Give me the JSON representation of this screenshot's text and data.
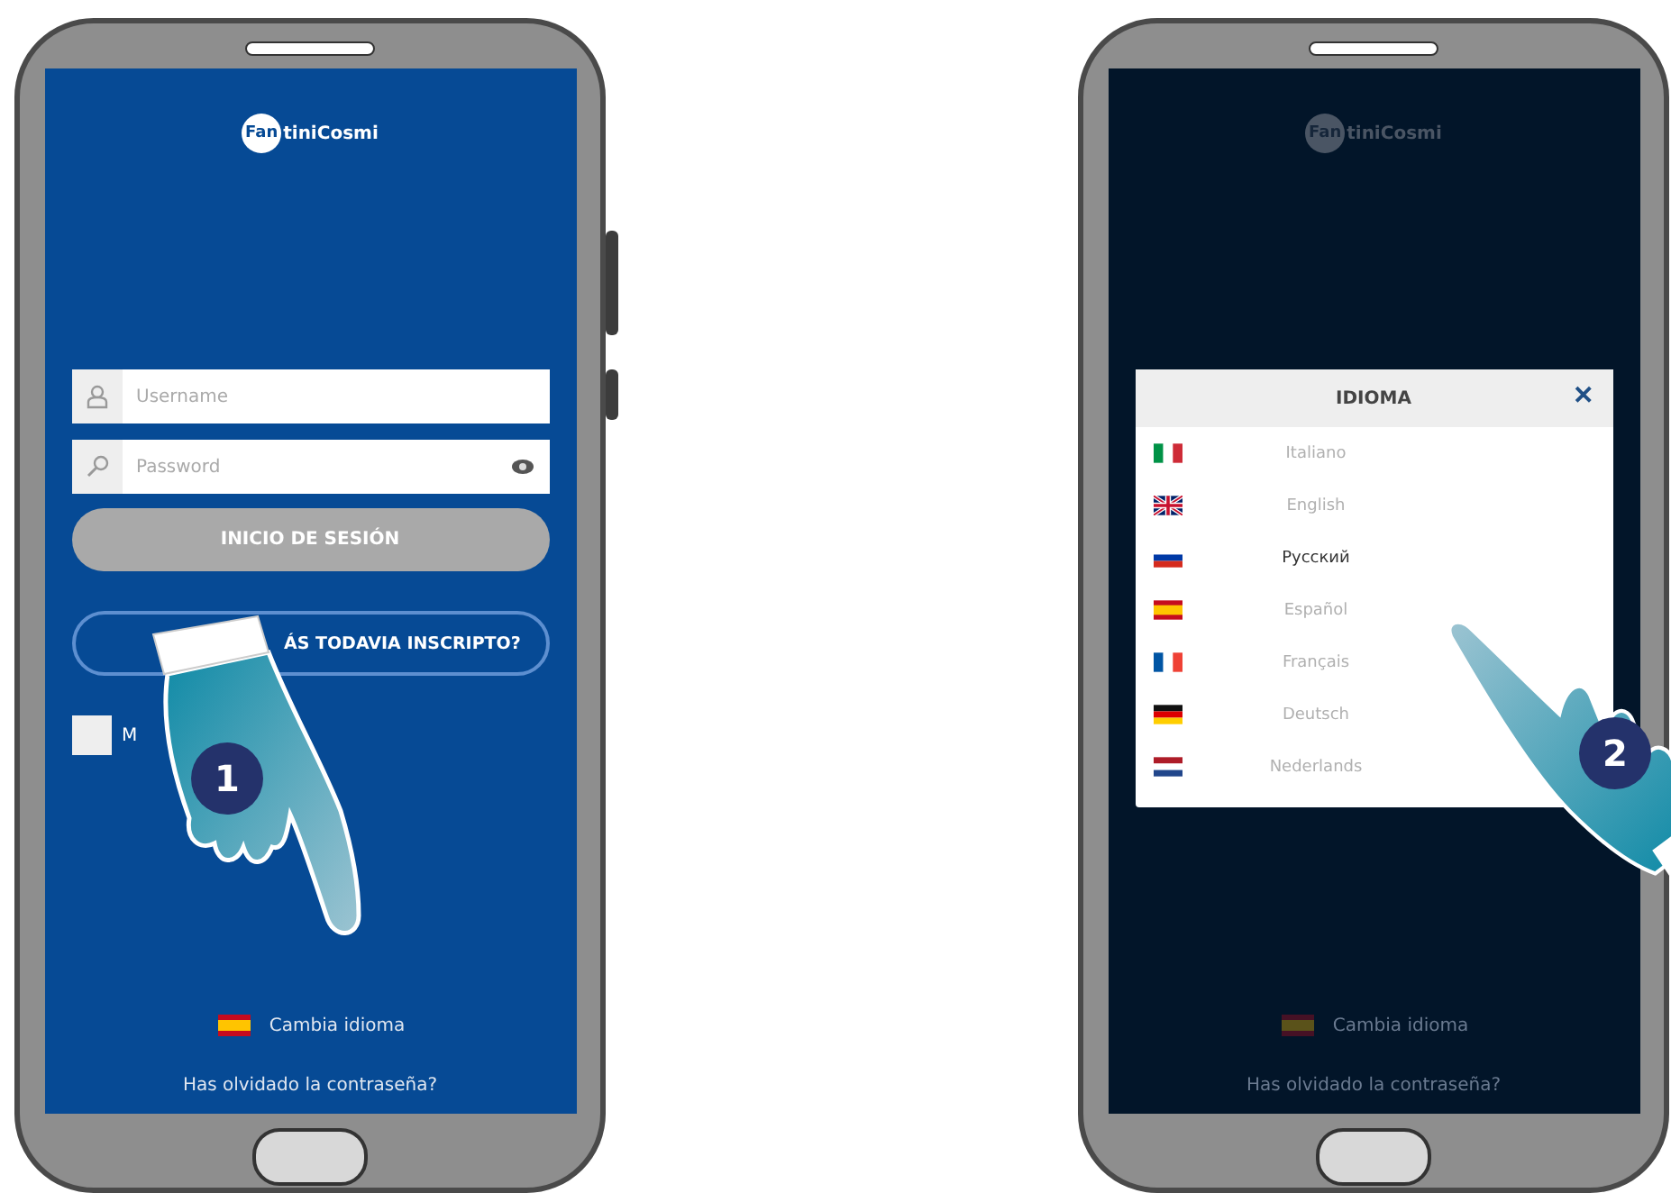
{
  "phones": [
    {
      "kind": "login",
      "side_buttons": true,
      "logo": {
        "mark": "Fan",
        "text": "tiniCosmi"
      },
      "username": {
        "placeholder": "Username"
      },
      "password": {
        "placeholder": "Password"
      },
      "login_button": "INICIO DE SESIÓN",
      "register_button": "ÁS TODAVIA INSCRIPTO?",
      "remember": {
        "label": "M",
        "checked": false
      },
      "language_link": {
        "label": "Cambia idioma",
        "kind": "es"
      },
      "forgot_link": "Has olvidado la contraseña?",
      "step": "1"
    },
    {
      "kind": "language",
      "side_buttons": false,
      "logo": {
        "mark": "Fan",
        "text": "tiniCosmi"
      },
      "dialog": {
        "title": "IDIOMA",
        "close": "✕",
        "languages": [
          {
            "label": "Italiano",
            "kind": "it",
            "selected": false
          },
          {
            "label": "English",
            "kind": "gb",
            "selected": false
          },
          {
            "label": "Русский",
            "kind": "ru",
            "selected": true
          },
          {
            "label": "Español",
            "kind": "es",
            "selected": false
          },
          {
            "label": "Français",
            "kind": "fr",
            "selected": false
          },
          {
            "label": "Deutsch",
            "kind": "de",
            "selected": false
          },
          {
            "label": "Nederlands",
            "kind": "nl",
            "selected": false
          }
        ]
      },
      "language_link": {
        "label": "Cambia idioma",
        "kind": "es"
      },
      "forgot_link": "Has olvidado la contraseña?",
      "step": "2"
    }
  ]
}
